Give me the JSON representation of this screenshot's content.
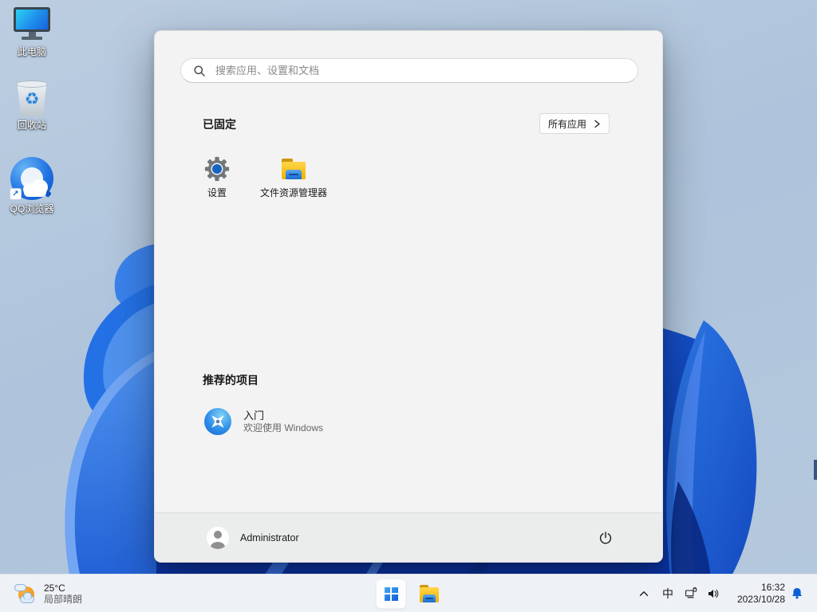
{
  "colors": {
    "accent": "#0b61d2",
    "panel_bg": "#f3f3f3",
    "panel_footer_bg": "#ebecec",
    "taskbar_bg": "#eef1f6",
    "wallpaper_sky": "#aec4dc",
    "bloom_blue": "#1b55d4",
    "text_primary": "#1b1b1b",
    "text_secondary": "#5f5f5f"
  },
  "desktop": {
    "icons": [
      {
        "label": "此电脑",
        "icon": "this-pc-icon"
      },
      {
        "label": "回收站",
        "icon": "recycle-bin-icon",
        "glyph": "♻"
      },
      {
        "label": "QQ浏览器",
        "icon": "qq-browser-icon",
        "shortcut_glyph": "↗"
      }
    ]
  },
  "start_menu": {
    "search": {
      "placeholder": "搜索应用、设置和文档"
    },
    "pinned": {
      "header": "已固定",
      "all_apps_label": "所有应用",
      "items": [
        {
          "label": "设置",
          "icon": "settings-gear-icon"
        },
        {
          "label": "文件资源管理器",
          "icon": "folder-icon"
        }
      ]
    },
    "recommended": {
      "header": "推荐的项目",
      "items": [
        {
          "title": "入门",
          "subtitle": "欢迎使用 Windows",
          "icon": "get-started-icon"
        }
      ]
    },
    "footer": {
      "user_name": "Administrator"
    }
  },
  "taskbar": {
    "widgets": {
      "temperature": "25°C",
      "condition": "局部晴朗"
    },
    "tray": {
      "ime": "中",
      "time": "16:32",
      "date": "2023/10/28"
    }
  }
}
